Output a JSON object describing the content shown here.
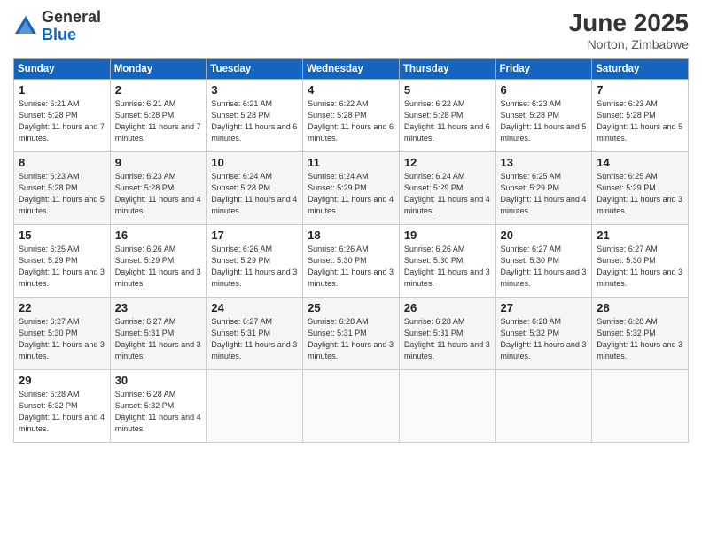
{
  "logo": {
    "general": "General",
    "blue": "Blue"
  },
  "title": "June 2025",
  "location": "Norton, Zimbabwe",
  "days_of_week": [
    "Sunday",
    "Monday",
    "Tuesday",
    "Wednesday",
    "Thursday",
    "Friday",
    "Saturday"
  ],
  "weeks": [
    [
      {
        "day": "1",
        "sunrise": "Sunrise: 6:21 AM",
        "sunset": "Sunset: 5:28 PM",
        "daylight": "Daylight: 11 hours and 7 minutes."
      },
      {
        "day": "2",
        "sunrise": "Sunrise: 6:21 AM",
        "sunset": "Sunset: 5:28 PM",
        "daylight": "Daylight: 11 hours and 7 minutes."
      },
      {
        "day": "3",
        "sunrise": "Sunrise: 6:21 AM",
        "sunset": "Sunset: 5:28 PM",
        "daylight": "Daylight: 11 hours and 6 minutes."
      },
      {
        "day": "4",
        "sunrise": "Sunrise: 6:22 AM",
        "sunset": "Sunset: 5:28 PM",
        "daylight": "Daylight: 11 hours and 6 minutes."
      },
      {
        "day": "5",
        "sunrise": "Sunrise: 6:22 AM",
        "sunset": "Sunset: 5:28 PM",
        "daylight": "Daylight: 11 hours and 6 minutes."
      },
      {
        "day": "6",
        "sunrise": "Sunrise: 6:23 AM",
        "sunset": "Sunset: 5:28 PM",
        "daylight": "Daylight: 11 hours and 5 minutes."
      },
      {
        "day": "7",
        "sunrise": "Sunrise: 6:23 AM",
        "sunset": "Sunset: 5:28 PM",
        "daylight": "Daylight: 11 hours and 5 minutes."
      }
    ],
    [
      {
        "day": "8",
        "sunrise": "Sunrise: 6:23 AM",
        "sunset": "Sunset: 5:28 PM",
        "daylight": "Daylight: 11 hours and 5 minutes."
      },
      {
        "day": "9",
        "sunrise": "Sunrise: 6:23 AM",
        "sunset": "Sunset: 5:28 PM",
        "daylight": "Daylight: 11 hours and 4 minutes."
      },
      {
        "day": "10",
        "sunrise": "Sunrise: 6:24 AM",
        "sunset": "Sunset: 5:28 PM",
        "daylight": "Daylight: 11 hours and 4 minutes."
      },
      {
        "day": "11",
        "sunrise": "Sunrise: 6:24 AM",
        "sunset": "Sunset: 5:29 PM",
        "daylight": "Daylight: 11 hours and 4 minutes."
      },
      {
        "day": "12",
        "sunrise": "Sunrise: 6:24 AM",
        "sunset": "Sunset: 5:29 PM",
        "daylight": "Daylight: 11 hours and 4 minutes."
      },
      {
        "day": "13",
        "sunrise": "Sunrise: 6:25 AM",
        "sunset": "Sunset: 5:29 PM",
        "daylight": "Daylight: 11 hours and 4 minutes."
      },
      {
        "day": "14",
        "sunrise": "Sunrise: 6:25 AM",
        "sunset": "Sunset: 5:29 PM",
        "daylight": "Daylight: 11 hours and 3 minutes."
      }
    ],
    [
      {
        "day": "15",
        "sunrise": "Sunrise: 6:25 AM",
        "sunset": "Sunset: 5:29 PM",
        "daylight": "Daylight: 11 hours and 3 minutes."
      },
      {
        "day": "16",
        "sunrise": "Sunrise: 6:26 AM",
        "sunset": "Sunset: 5:29 PM",
        "daylight": "Daylight: 11 hours and 3 minutes."
      },
      {
        "day": "17",
        "sunrise": "Sunrise: 6:26 AM",
        "sunset": "Sunset: 5:29 PM",
        "daylight": "Daylight: 11 hours and 3 minutes."
      },
      {
        "day": "18",
        "sunrise": "Sunrise: 6:26 AM",
        "sunset": "Sunset: 5:30 PM",
        "daylight": "Daylight: 11 hours and 3 minutes."
      },
      {
        "day": "19",
        "sunrise": "Sunrise: 6:26 AM",
        "sunset": "Sunset: 5:30 PM",
        "daylight": "Daylight: 11 hours and 3 minutes."
      },
      {
        "day": "20",
        "sunrise": "Sunrise: 6:27 AM",
        "sunset": "Sunset: 5:30 PM",
        "daylight": "Daylight: 11 hours and 3 minutes."
      },
      {
        "day": "21",
        "sunrise": "Sunrise: 6:27 AM",
        "sunset": "Sunset: 5:30 PM",
        "daylight": "Daylight: 11 hours and 3 minutes."
      }
    ],
    [
      {
        "day": "22",
        "sunrise": "Sunrise: 6:27 AM",
        "sunset": "Sunset: 5:30 PM",
        "daylight": "Daylight: 11 hours and 3 minutes."
      },
      {
        "day": "23",
        "sunrise": "Sunrise: 6:27 AM",
        "sunset": "Sunset: 5:31 PM",
        "daylight": "Daylight: 11 hours and 3 minutes."
      },
      {
        "day": "24",
        "sunrise": "Sunrise: 6:27 AM",
        "sunset": "Sunset: 5:31 PM",
        "daylight": "Daylight: 11 hours and 3 minutes."
      },
      {
        "day": "25",
        "sunrise": "Sunrise: 6:28 AM",
        "sunset": "Sunset: 5:31 PM",
        "daylight": "Daylight: 11 hours and 3 minutes."
      },
      {
        "day": "26",
        "sunrise": "Sunrise: 6:28 AM",
        "sunset": "Sunset: 5:31 PM",
        "daylight": "Daylight: 11 hours and 3 minutes."
      },
      {
        "day": "27",
        "sunrise": "Sunrise: 6:28 AM",
        "sunset": "Sunset: 5:32 PM",
        "daylight": "Daylight: 11 hours and 3 minutes."
      },
      {
        "day": "28",
        "sunrise": "Sunrise: 6:28 AM",
        "sunset": "Sunset: 5:32 PM",
        "daylight": "Daylight: 11 hours and 3 minutes."
      }
    ],
    [
      {
        "day": "29",
        "sunrise": "Sunrise: 6:28 AM",
        "sunset": "Sunset: 5:32 PM",
        "daylight": "Daylight: 11 hours and 4 minutes."
      },
      {
        "day": "30",
        "sunrise": "Sunrise: 6:28 AM",
        "sunset": "Sunset: 5:32 PM",
        "daylight": "Daylight: 11 hours and 4 minutes."
      },
      null,
      null,
      null,
      null,
      null
    ]
  ]
}
